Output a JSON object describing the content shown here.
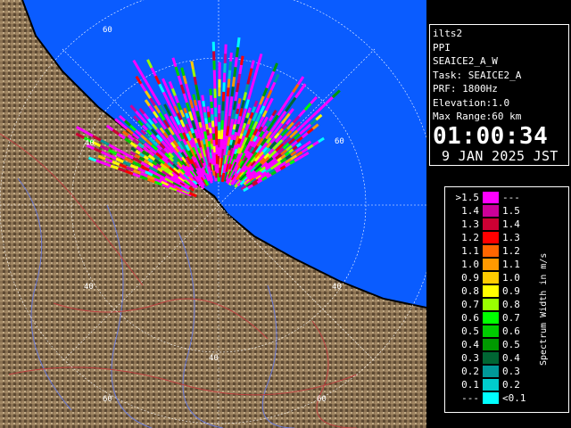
{
  "info": {
    "radar": "ilts2",
    "mode": "PPI",
    "scan": "SEAICE2_A_W",
    "task": "Task: SEAICE2_A",
    "prf": "PRF: 1800Hz",
    "elevation": "Elevation:1.0",
    "max_range": "Max Range:60 km",
    "time": "01:00:34",
    "date": "9 JAN 2025 JST"
  },
  "range_labels": [
    "60",
    "40",
    "40",
    "40",
    "40",
    "60",
    "60",
    "60"
  ],
  "legend": {
    "title": "Spectrum Width in m/s",
    "rows": [
      {
        "left": ">1.5",
        "right": "---",
        "color": "#ff00ff"
      },
      {
        "left": "1.4",
        "right": "1.5",
        "color": "#cc0099"
      },
      {
        "left": "1.3",
        "right": "1.4",
        "color": "#cc0033"
      },
      {
        "left": "1.2",
        "right": "1.3",
        "color": "#ff0000"
      },
      {
        "left": "1.1",
        "right": "1.2",
        "color": "#ff6600"
      },
      {
        "left": "1.0",
        "right": "1.1",
        "color": "#ff9900"
      },
      {
        "left": "0.9",
        "right": "1.0",
        "color": "#ffcc00"
      },
      {
        "left": "0.8",
        "right": "0.9",
        "color": "#ffff00"
      },
      {
        "left": "0.7",
        "right": "0.8",
        "color": "#99ff00"
      },
      {
        "left": "0.6",
        "right": "0.7",
        "color": "#00ff00"
      },
      {
        "left": "0.5",
        "right": "0.6",
        "color": "#00cc00"
      },
      {
        "left": "0.4",
        "right": "0.5",
        "color": "#009900"
      },
      {
        "left": "0.3",
        "right": "0.4",
        "color": "#006633"
      },
      {
        "left": "0.2",
        "right": "0.3",
        "color": "#009999"
      },
      {
        "left": "0.1",
        "right": "0.2",
        "color": "#00cccc"
      },
      {
        "left": "---",
        "right": "<0.1",
        "color": "#00ffff"
      }
    ]
  },
  "colors": {
    "sea": "#0a5cff",
    "land": "#8a7152",
    "range_ring": "#ffffff",
    "coastline": "#000000"
  }
}
